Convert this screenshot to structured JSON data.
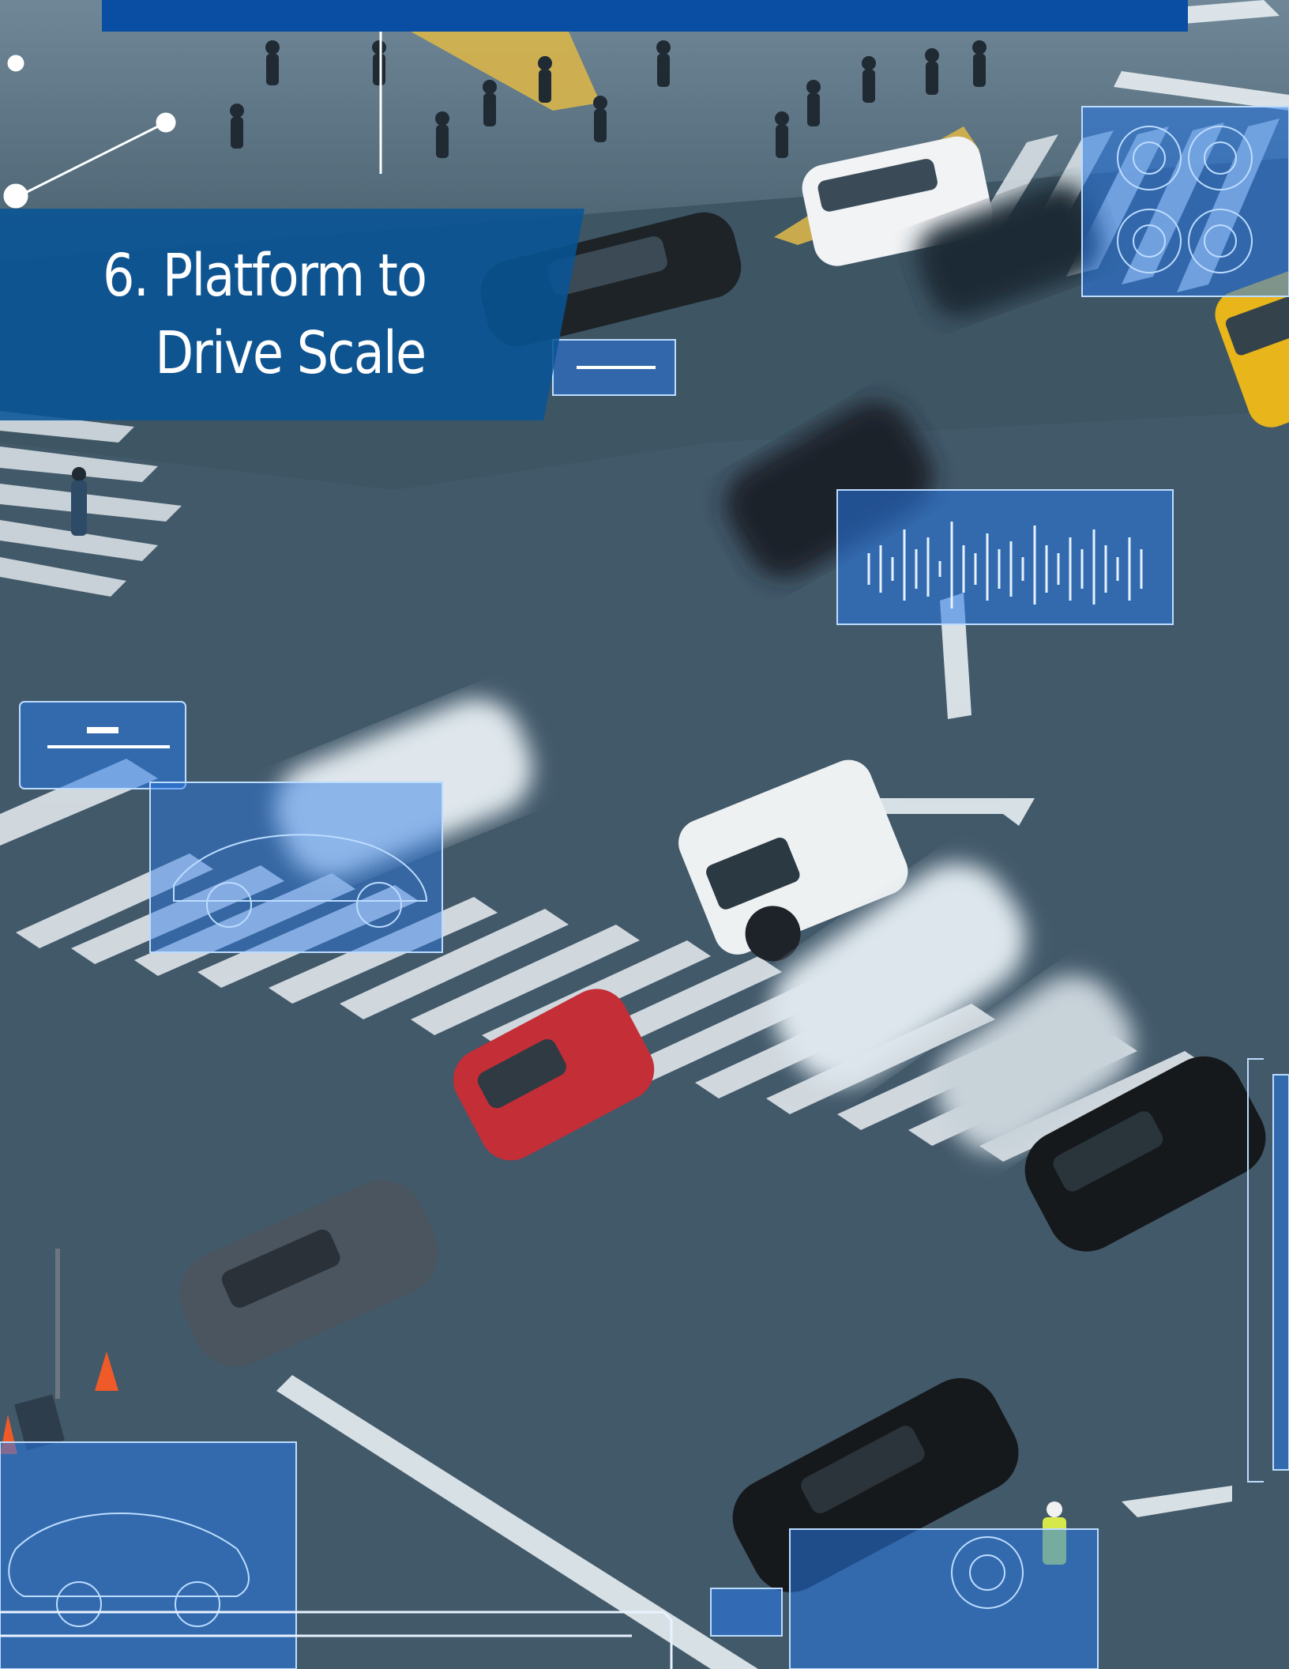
{
  "page": {
    "title_line1": "6. Platform to",
    "title_line2": "Drive Scale"
  },
  "colors": {
    "accent_blue": "#0a4ea3",
    "title_panel": "#0a5496",
    "asphalt": "#3f5666",
    "hud_blue": "#2a7fe0",
    "title_text": "#ffffff"
  },
  "image": {
    "subject": "aerial view of a city intersection with cars, crosswalks and pedestrians, overlaid with blue HUD panels"
  }
}
